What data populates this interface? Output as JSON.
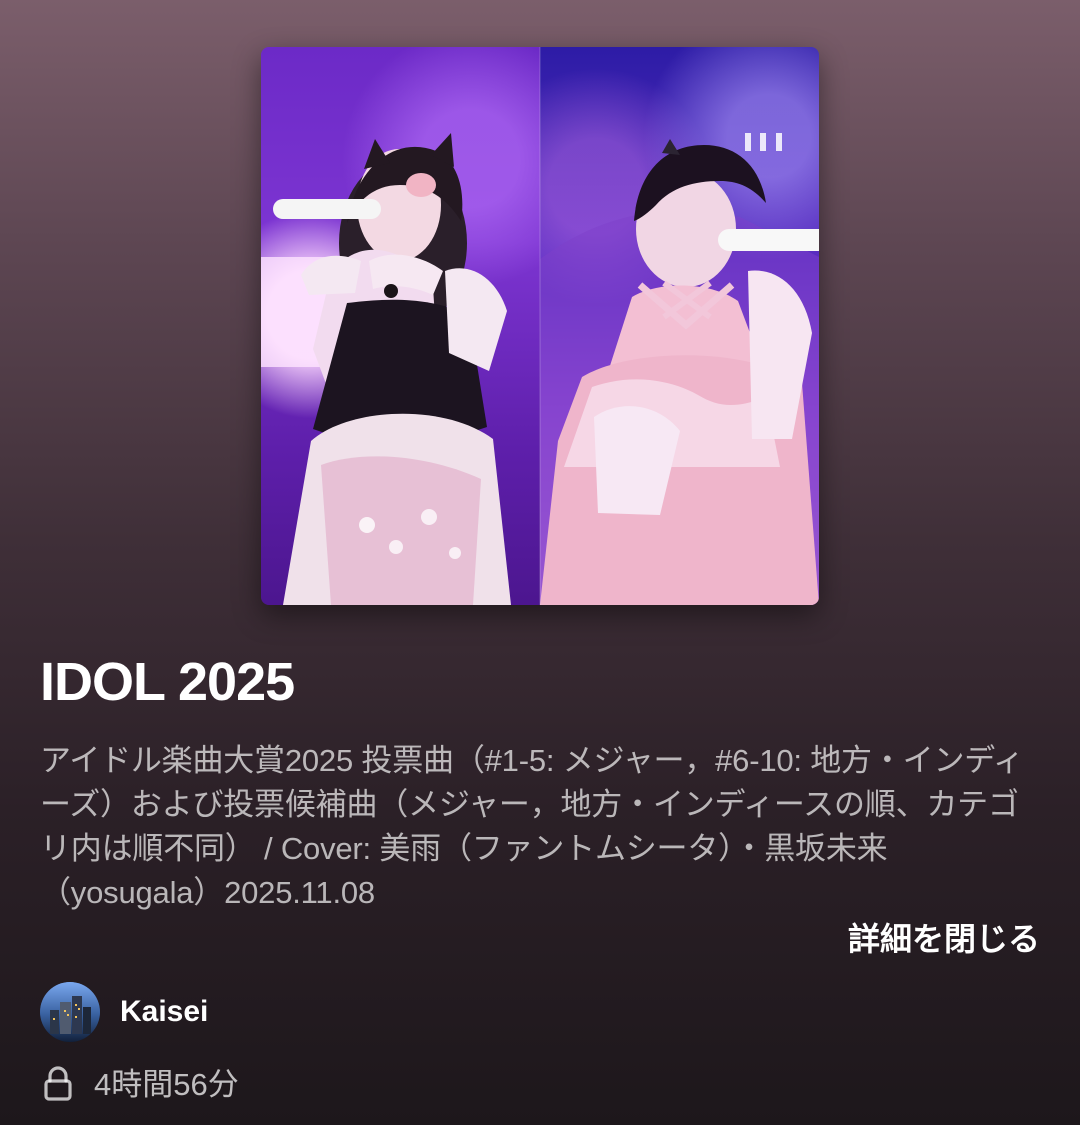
{
  "playlist": {
    "title": "IDOL 2025",
    "description": "アイドル楽曲大賞2025 投票曲（#1-5: メジャー，#6-10: 地方・インディーズ）および投票候補曲（メジャー，地方・インディースの順、カテゴリ内は順不同） / Cover: 美雨（ファントムシータ）・黒坂未来（yosugala）2025.11.08",
    "details_toggle_label": "詳細を閉じる",
    "owner": {
      "name": "Kaisei"
    },
    "meta": {
      "duration": "4時間56分"
    }
  },
  "icons": {
    "privacy": "lock-icon"
  },
  "colors": {
    "background_top": "#7b5e6b",
    "background_bottom": "#1d171b",
    "text_primary": "#ffffff",
    "text_secondary": "#b8adb3"
  }
}
